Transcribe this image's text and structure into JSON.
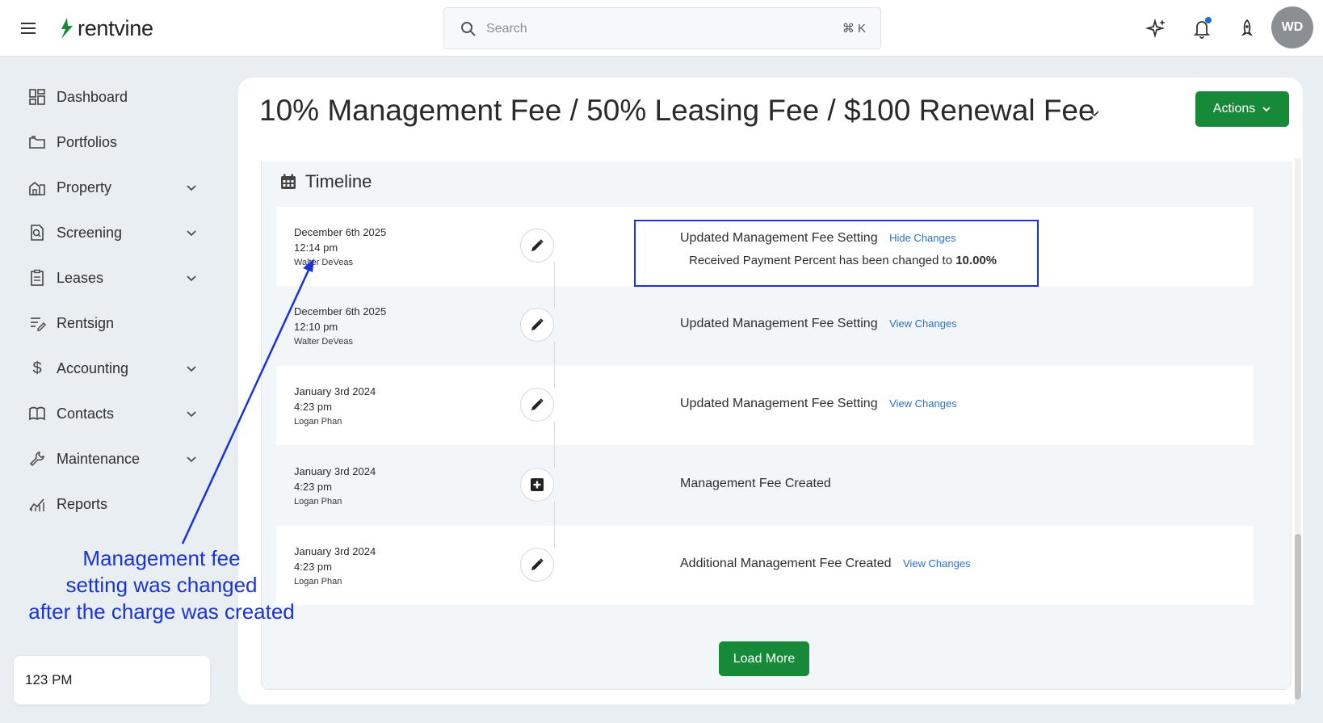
{
  "app": {
    "brand": "rentvine"
  },
  "search": {
    "placeholder": "Search",
    "shortcut": "⌘ K"
  },
  "user": {
    "initials": "WD"
  },
  "sidebar": {
    "items": [
      {
        "label": "Dashboard",
        "icon": "dashboard-icon",
        "expandable": false
      },
      {
        "label": "Portfolios",
        "icon": "folder-icon",
        "expandable": false
      },
      {
        "label": "Property",
        "icon": "property-icon",
        "expandable": true
      },
      {
        "label": "Screening",
        "icon": "screening-icon",
        "expandable": true
      },
      {
        "label": "Leases",
        "icon": "lease-icon",
        "expandable": true
      },
      {
        "label": "Rentsign",
        "icon": "sign-icon",
        "expandable": false
      },
      {
        "label": "Accounting",
        "icon": "dollar-icon",
        "expandable": true
      },
      {
        "label": "Contacts",
        "icon": "book-icon",
        "expandable": true
      },
      {
        "label": "Maintenance",
        "icon": "wrench-icon",
        "expandable": true
      },
      {
        "label": "Reports",
        "icon": "chart-icon",
        "expandable": false
      }
    ],
    "footer_label": "123 PM"
  },
  "page": {
    "title": "10% Management Fee / 50% Leasing Fee / $100 Renewal Fee",
    "actions_label": "Actions"
  },
  "timeline": {
    "heading": "Timeline",
    "entries": [
      {
        "date": "December 6th 2025",
        "time": "12:14 pm",
        "user": "Walter DeVeas",
        "icon": "pencil-icon",
        "title": "Updated Management Fee Setting",
        "link": "Hide Changes",
        "change_text": "Received Payment Percent has been changed to",
        "change_value": "10.00%"
      },
      {
        "date": "December 6th 2025",
        "time": "12:10 pm",
        "user": "Walter DeVeas",
        "icon": "pencil-icon",
        "title": "Updated Management Fee Setting",
        "link": "View Changes"
      },
      {
        "date": "January 3rd 2024",
        "time": "4:23 pm",
        "user": "Logan Phan",
        "icon": "pencil-icon",
        "title": "Updated Management Fee Setting",
        "link": "View Changes"
      },
      {
        "date": "January 3rd 2024",
        "time": "4:23 pm",
        "user": "Logan Phan",
        "icon": "plus-square-icon",
        "title": "Management Fee Created",
        "link": ""
      },
      {
        "date": "January 3rd 2024",
        "time": "4:23 pm",
        "user": "Logan Phan",
        "icon": "pencil-icon",
        "title": "Additional Management Fee Created",
        "link": "View Changes"
      }
    ],
    "load_more_label": "Load More"
  },
  "annotation": {
    "lines": [
      "Management fee",
      "setting was changed",
      "after the charge was created"
    ],
    "color": "#1a33d8"
  },
  "colors": {
    "primary_green": "#178a3a",
    "link_blue": "#2a72c8"
  }
}
